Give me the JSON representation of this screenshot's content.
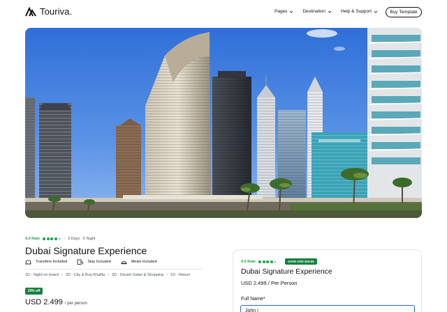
{
  "header": {
    "brand": "Touriva.",
    "nav": [
      {
        "label": "Pages"
      },
      {
        "label": "Destination"
      },
      {
        "label": "Help & Support"
      }
    ],
    "cta_label": "Buy Template"
  },
  "hero": {
    "image": "dubai-marina-skyline"
  },
  "tour": {
    "rate_label": "4.0 Rate",
    "rating_filled": 4,
    "rating_total": 5,
    "duration": "3 Days - 5 Night",
    "title": "Dubai Signature Experience",
    "features": [
      {
        "icon": "car-icon",
        "label": "Transfers Included"
      },
      {
        "icon": "hotel-icon",
        "label": "Stay Included"
      },
      {
        "icon": "meal-icon",
        "label": "Meals Included"
      }
    ],
    "itinerary": [
      "1D - Night on board",
      "2D - City & Burj Khalifa",
      "2D - Desert Safari & Shopping",
      "1D - Return"
    ],
    "discount_badge": "10% off",
    "price": "USD 2.499",
    "price_unit": "/ per person"
  },
  "booking": {
    "rate_label": "4.0 Rate",
    "save_badge": "SAVE USD $18.55",
    "title": "Dubai Signature Experience",
    "price": "USD 2.499 / Per Person",
    "fullname_label": "Full Name*",
    "fullname_value": "John |"
  },
  "colors": {
    "accent_green": "#15803d",
    "focus_blue": "#2563eb"
  }
}
